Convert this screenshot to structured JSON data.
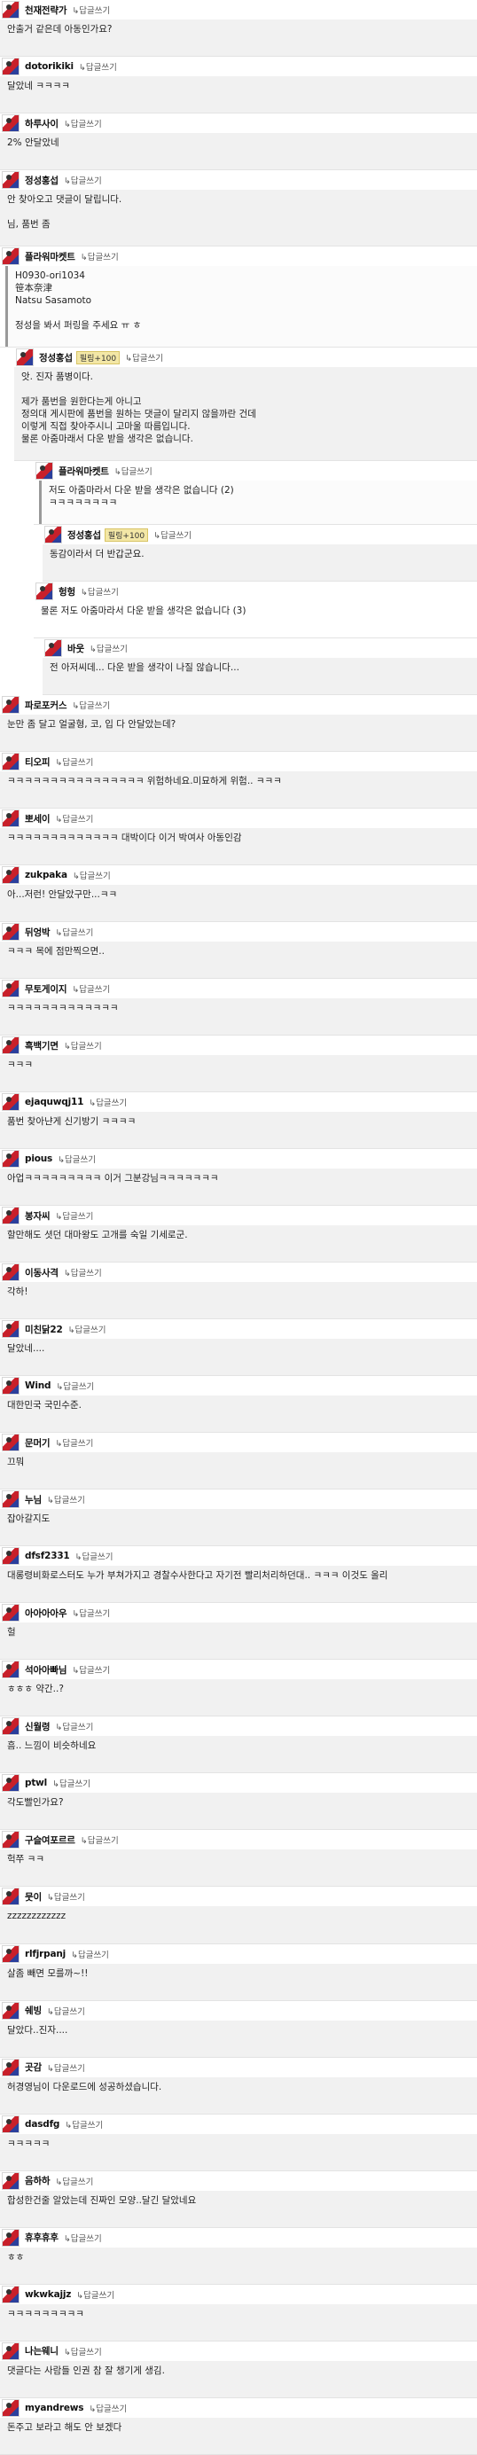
{
  "reply_label": "↳답글쓰기",
  "comments": [
    {
      "nick": "천재전략가",
      "level": 0,
      "text": "안출거 같은데 아동인가요?",
      "hl": false
    },
    {
      "nick": "dotorikiki",
      "level": 0,
      "text": "달았네 ㅋㅋㅋㅋ",
      "hl": false
    },
    {
      "nick": "하루사이",
      "level": 0,
      "text": "2% 안달았네",
      "hl": false
    },
    {
      "nick": "정성홍섭",
      "level": 0,
      "text": "안 찾아오고 댓글이 달립니다.\n\n님, 품번 좀",
      "hl": false
    },
    {
      "nick": "플라워마켓트",
      "level": 0,
      "text": "H0930-ori1034\n笹本奈津\nNatsu Sasamoto\n\n정성을 봐서 퍼링을 주세요 ㅠ ㅎ",
      "hl": false,
      "box": true
    },
    {
      "nick": "정성홍섭",
      "level": 1,
      "badge": "필링+100",
      "text": "앗. 진자 품병이다.\n\n제가 품번을 원한다는게 아니고\n정의대 게시판에 품번을 원하는 댓글이 달리지 않을까란 건데\n이렇게 직접 찾아주시니 고마울 따름입니다.\n물론 아줌마래서 다운 받을 생각은 없습니다.",
      "hl": false
    },
    {
      "nick": "플라워마켓트",
      "level": 2,
      "text": "저도 아줌마라서 다운 받을 생각은 없습니다 (2)\nㅋㅋㅋㅋㅋㅋㅋㅋ",
      "hl": false,
      "box": true
    },
    {
      "nick": "정성홍섭",
      "level": 3,
      "badge": "필링+100",
      "text": "동감이라서 더 반갑군요.",
      "hl": false
    },
    {
      "nick": "헝헝",
      "level": 2,
      "text": "물론 저도 아줌마라서 다운 받을 생각은 없습니다 (3)",
      "hl": true
    },
    {
      "nick": "바웃",
      "level": 3,
      "text": "전 아저씨데... 다운 받을 생각이 나질 않습니다...",
      "hl": false
    },
    {
      "nick": "파로포커스",
      "level": 0,
      "text": "눈만 좀 달고 얼굴형, 코, 입 다 안달았는데?",
      "hl": false
    },
    {
      "nick": "티오피",
      "level": 0,
      "text": "ㅋㅋㅋㅋㅋㅋㅋㅋㅋㅋㅋㅋㅋㅋㅋㅋ 위험하네요.미묘하게 위험.. ㅋㅋㅋ",
      "hl": false
    },
    {
      "nick": "뽀세이",
      "level": 0,
      "text": "ㅋㅋㅋㅋㅋㅋㅋㅋㅋㅋㅋㅋㅋ 대박이다 이거 박여사 아동인감",
      "hl": false
    },
    {
      "nick": "zukpaka",
      "level": 0,
      "text": "아...저런! 안달았구만...ㅋㅋ",
      "hl": false
    },
    {
      "nick": "뒤엉박",
      "level": 0,
      "text": "ㅋㅋㅋ 목에 점만찍으면..",
      "hl": false
    },
    {
      "nick": "무토게이지",
      "level": 0,
      "text": "ㅋㅋㅋㅋㅋㅋㅋㅋㅋㅋㅋㅋㅋ",
      "hl": false
    },
    {
      "nick": "흑백기면",
      "level": 0,
      "text": "ㅋㅋㅋ",
      "hl": false
    },
    {
      "nick": "ejaquwqj11",
      "level": 0,
      "text": "품번 찾아냔게 신기방기 ㅋㅋㅋㅋ",
      "hl": false
    },
    {
      "nick": "pious",
      "level": 0,
      "text": "아업ㅋㅋㅋㅋㅋㅋㅋㅋㅋ 이거 그분강님ㅋㅋㅋㅋㅋㅋㅋ",
      "hl": false
    },
    {
      "nick": "봉자씨",
      "level": 0,
      "text": "할만해도 셧던 대마왕도 고개를 숙일 기세로군.",
      "hl": false
    },
    {
      "nick": "이동사격",
      "level": 0,
      "text": "각하!",
      "hl": false
    },
    {
      "nick": "미친닭22",
      "level": 0,
      "text": "달았네....",
      "hl": false
    },
    {
      "nick": "Wind",
      "level": 0,
      "text": "대한민국 국민수준.",
      "hl": false
    },
    {
      "nick": "문머기",
      "level": 0,
      "text": "끄뭐",
      "hl": false
    },
    {
      "nick": "누님",
      "level": 0,
      "text": "잡아갈지도",
      "hl": false
    },
    {
      "nick": "dfsf2331",
      "level": 0,
      "text": "대롱령비화로스터도 누가 부쳐가지고 경찰수사한다고 자기전 빨리처리하던대.. ㅋㅋㅋ 이것도 올리",
      "hl": false
    },
    {
      "nick": "아아아아우",
      "level": 0,
      "text": "헐",
      "hl": false
    },
    {
      "nick": "석아아빠님",
      "level": 0,
      "text": "ㅎㅎㅎ 약간..?",
      "hl": false
    },
    {
      "nick": "신월령",
      "level": 0,
      "text": "흠.. 느낌이 비슷하네요",
      "hl": false
    },
    {
      "nick": "ptwl",
      "level": 0,
      "text": "각도빨인가요?",
      "hl": false
    },
    {
      "nick": "구슬여포르르",
      "level": 0,
      "text": "헉쭈 ㅋㅋ",
      "hl": false
    },
    {
      "nick": "뭇이",
      "level": 0,
      "text": "zzzzzzzzzzzz",
      "hl": false
    },
    {
      "nick": "rlfjrpanj",
      "level": 0,
      "text": "살좀 빼면 모를까~!!",
      "hl": false
    },
    {
      "nick": "쉐빙",
      "level": 0,
      "text": "달았다..진자....",
      "hl": false
    },
    {
      "nick": "곳감",
      "level": 0,
      "text": "허경영님이 다운로드에 성공하셨습니다.",
      "hl": false
    },
    {
      "nick": "dasdfg",
      "level": 0,
      "text": "ㅋㅋㅋㅋㅋ",
      "hl": false
    },
    {
      "nick": "음하하",
      "level": 0,
      "text": "합성한건줄 알았는데 진짜인 모양..달긴 달았네요",
      "hl": false
    },
    {
      "nick": "휴후휴후",
      "level": 0,
      "text": "ㅎㅎ",
      "hl": false
    },
    {
      "nick": "wkwkajjz",
      "level": 0,
      "text": "ㅋㅋㅋㅋㅋㅋㅋㅋㅋ",
      "hl": false
    },
    {
      "nick": "나는웨니",
      "level": 0,
      "text": "댓글다는 사람들 인권 참 잘 챙기게 생김.",
      "hl": false
    },
    {
      "nick": "myandrews",
      "level": 0,
      "text": "돈주고 보라고 해도 안 보겠다",
      "hl": false
    }
  ]
}
